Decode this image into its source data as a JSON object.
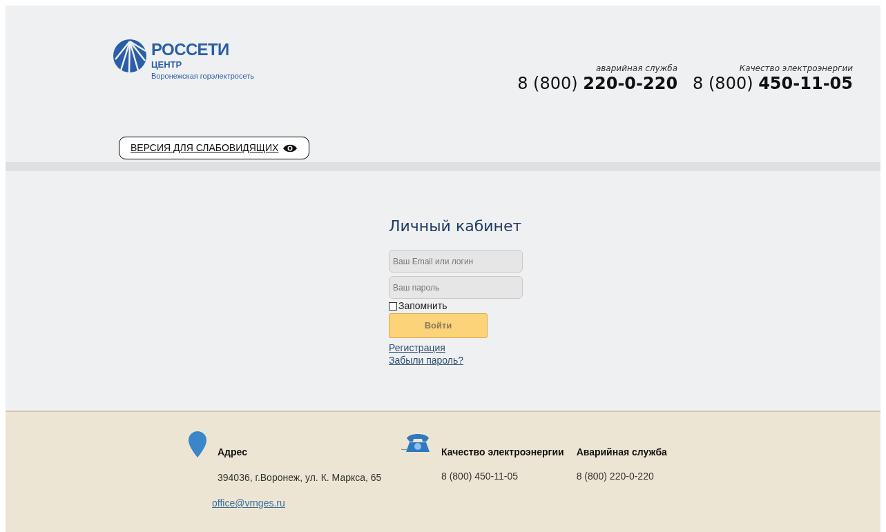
{
  "logo": {
    "brand": "РОССЕТИ",
    "division": "ЦЕНТР",
    "subtitle": "Воронежская горэлектросеть"
  },
  "header_phones": [
    {
      "caption": "аварийная служба",
      "number": "8 (800) **220-0-220**"
    },
    {
      "caption": "Качество электроэнергии",
      "number": "8 (800) **450-11-05**"
    }
  ],
  "accessibility_button": {
    "label": "ВЕРСИЯ ДЛЯ СЛАБОВИДЯЩИХ"
  },
  "login": {
    "title": "Личный кабинет",
    "login_field": {
      "placeholder": "Ваш Email или логин"
    },
    "password_field": {
      "placeholder": "Ваш пароль"
    },
    "remember": {
      "label": "Запомнить",
      "checked": false
    },
    "submit": "Войти",
    "links": [
      "Регистрация",
      "Забыли пароль?"
    ]
  },
  "footer": {
    "address": {
      "title": "Адрес",
      "text": "394036, г.Воронеж, ул. К. Маркса, 65",
      "email": "office@vrnges.ru"
    },
    "contacts": [
      {
        "title": "Качество электроэнергии",
        "phone": "8 (800) 450-11-05"
      },
      {
        "title": "Аварийная служба",
        "phone": "8 (800) 220-0-220"
      }
    ]
  }
}
